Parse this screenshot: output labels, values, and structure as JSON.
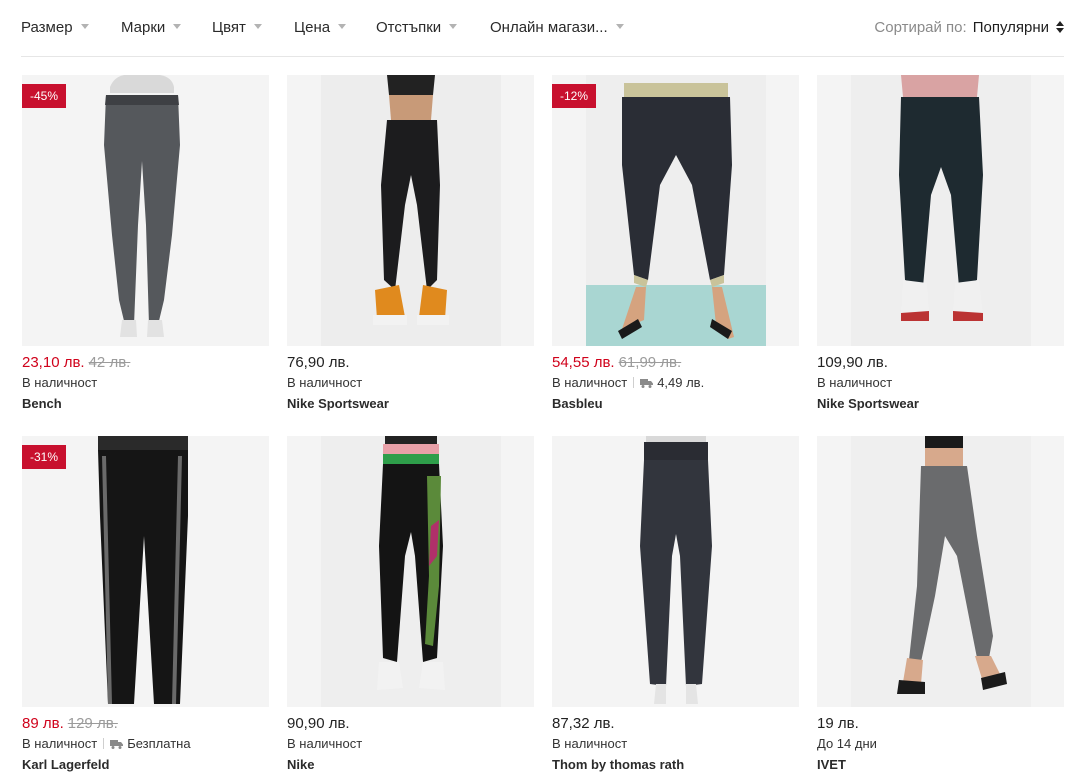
{
  "filters": [
    {
      "label": "Размер"
    },
    {
      "label": "Марки"
    },
    {
      "label": "Цвят"
    },
    {
      "label": "Цена"
    },
    {
      "label": "Отстъпки"
    },
    {
      "label": "Онлайн магази..."
    }
  ],
  "sort": {
    "label": "Сортирай по:",
    "value": "Популярни"
  },
  "colors": {
    "sale": "#d0021b",
    "badge": "#c8102e",
    "muted": "#9b9b9b"
  },
  "products": [
    {
      "badge": "-45%",
      "price": "23,10 лв.",
      "old_price": "42 лв.",
      "availability": "В наличност",
      "shipping": "",
      "brand": "Bench",
      "image": "grey-melange-leggings-on-mannequin"
    },
    {
      "badge": "",
      "price": "76,90 лв.",
      "old_price": "",
      "availability": "В наличност",
      "shipping": "",
      "brand": "Nike Sportswear",
      "image": "black-joggers-model-orange-sneakers"
    },
    {
      "badge": "-12%",
      "price": "54,55 лв.",
      "old_price": "61,99 лв.",
      "availability": "В наличност",
      "shipping": "4,49 лв.",
      "brand": "Basbleu",
      "image": "navy-trousers-model-heels"
    },
    {
      "badge": "",
      "price": "109,90 лв.",
      "old_price": "",
      "availability": "В наличност",
      "shipping": "",
      "brand": "Nike Sportswear",
      "image": "dark-green-joggers-model-white-sneakers"
    },
    {
      "badge": "-31%",
      "price": "89 лв.",
      "old_price": "129 лв.",
      "availability": "В наличност",
      "shipping": "Безплатна",
      "brand": "Karl Lagerfeld",
      "image": "black-leggings-side-stripe-mannequin"
    },
    {
      "badge": "",
      "price": "90,90 лв.",
      "old_price": "",
      "availability": "В наличност",
      "shipping": "",
      "brand": "Nike",
      "image": "black-floral-leggings-model-white-sneakers"
    },
    {
      "badge": "",
      "price": "87,32 лв.",
      "old_price": "",
      "availability": "В наличност",
      "shipping": "",
      "brand": "Thom by thomas rath",
      "image": "dark-denim-jeggings-on-mannequin"
    },
    {
      "badge": "",
      "price": "19 лв.",
      "old_price": "",
      "availability": "До 14 дни",
      "shipping": "",
      "brand": "IVET",
      "image": "grey-leggings-model-black-sneakers"
    }
  ]
}
